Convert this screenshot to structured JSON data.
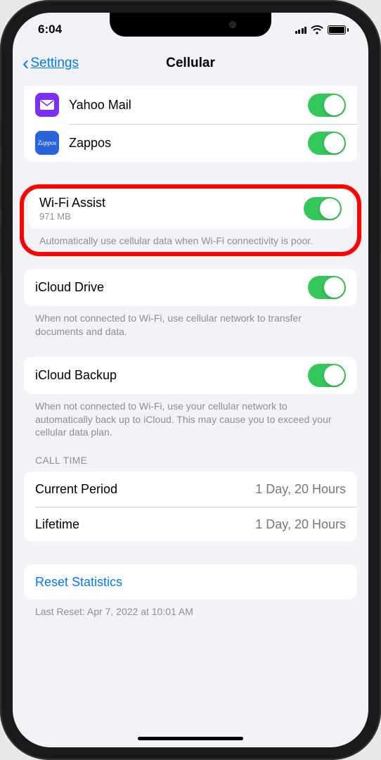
{
  "status": {
    "time": "6:04"
  },
  "nav": {
    "back": "Settings",
    "title": "Cellular"
  },
  "apps": [
    {
      "name": "Yahoo Mail",
      "icon": "yahoo",
      "enabled": true
    },
    {
      "name": "Zappos",
      "icon": "zappos",
      "enabled": true
    }
  ],
  "wifi_assist": {
    "title": "Wi-Fi Assist",
    "usage": "971 MB",
    "enabled": true,
    "description": "Automatically use cellular data when Wi-Fi connectivity is poor."
  },
  "icloud_drive": {
    "title": "iCloud Drive",
    "enabled": true,
    "description": "When not connected to Wi-Fi, use cellular network to transfer documents and data."
  },
  "icloud_backup": {
    "title": "iCloud Backup",
    "enabled": true,
    "description": "When not connected to Wi-Fi, use your cellular network to automatically back up to iCloud. This may cause you to exceed your cellular data plan."
  },
  "call_time": {
    "header": "CALL TIME",
    "rows": [
      {
        "label": "Current Period",
        "value": "1 Day, 20 Hours"
      },
      {
        "label": "Lifetime",
        "value": "1 Day, 20 Hours"
      }
    ]
  },
  "reset": {
    "label": "Reset Statistics",
    "last_reset": "Last Reset: Apr 7, 2022 at 10:01 AM"
  }
}
